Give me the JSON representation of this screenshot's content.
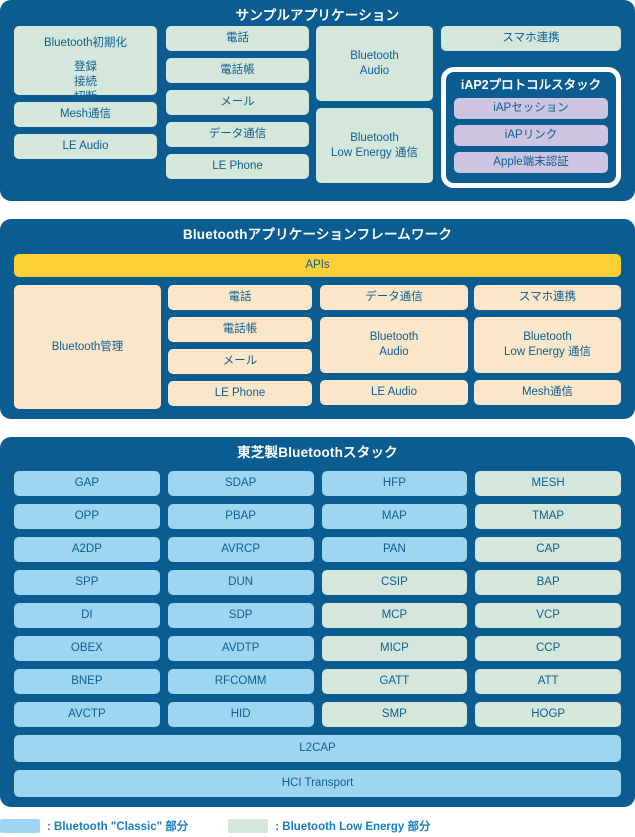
{
  "colors": {
    "panel_navy": "#0a5c91",
    "classic_blue": "#9ed5f0",
    "low_energy_green": "#d5e7da",
    "framework_beige": "#fae6c8",
    "apis_yellow": "#fbd034",
    "iap_purple": "#ccc4e0",
    "box_text": "#0f5e94",
    "legend_text": "#1a7fc1"
  },
  "sample_application": {
    "title": "サンプルアプリケーション",
    "column1": {
      "init_box": {
        "heading": "Bluetooth初期化",
        "lines": "登録\n接続\n切断"
      },
      "mesh": "Mesh通信",
      "le_audio": "LE Audio"
    },
    "column2": {
      "phone": "電話",
      "phonebook": "電話帳",
      "mail": "メール",
      "data_comm": "データ通信",
      "le_phone": "LE Phone"
    },
    "column3": {
      "bt_audio": "Bluetooth\nAudio",
      "bt_le_comm": "Bluetooth\nLow Energy 通信"
    },
    "column4": {
      "smartphone_link": "スマホ連携"
    },
    "iap2": {
      "title": "iAP2プロトコルスタック",
      "items": [
        "iAPセッション",
        "iAPリンク",
        "Apple端末認証"
      ]
    }
  },
  "framework": {
    "title": "Bluetoothアプリケーションフレームワーク",
    "apis": "APIs",
    "column1": {
      "management": "Bluetooth管理"
    },
    "column2": {
      "phone": "電話",
      "phonebook": "電話帳",
      "mail": "メール",
      "le_phone": "LE Phone"
    },
    "column3": {
      "data_comm": "データ通信",
      "bt_audio": "Bluetooth\nAudio",
      "le_audio": "LE Audio"
    },
    "column4": {
      "smartphone_link": "スマホ連携",
      "bt_le_comm": "Bluetooth\nLow Energy 通信",
      "mesh": "Mesh通信"
    }
  },
  "stack": {
    "title": "東芝製Bluetoothスタック",
    "grid": [
      [
        {
          "label": "GAP",
          "kind": "blue"
        },
        {
          "label": "SDAP",
          "kind": "blue"
        },
        {
          "label": "HFP",
          "kind": "blue"
        },
        {
          "label": "MESH",
          "kind": "green"
        }
      ],
      [
        {
          "label": "OPP",
          "kind": "blue"
        },
        {
          "label": "PBAP",
          "kind": "blue"
        },
        {
          "label": "MAP",
          "kind": "blue"
        },
        {
          "label": "TMAP",
          "kind": "green"
        }
      ],
      [
        {
          "label": "A2DP",
          "kind": "blue"
        },
        {
          "label": "AVRCP",
          "kind": "blue"
        },
        {
          "label": "PAN",
          "kind": "blue"
        },
        {
          "label": "CAP",
          "kind": "green"
        }
      ],
      [
        {
          "label": "SPP",
          "kind": "blue"
        },
        {
          "label": "DUN",
          "kind": "blue"
        },
        {
          "label": "CSIP",
          "kind": "green"
        },
        {
          "label": "BAP",
          "kind": "green"
        }
      ],
      [
        {
          "label": "DI",
          "kind": "blue"
        },
        {
          "label": "SDP",
          "kind": "blue"
        },
        {
          "label": "MCP",
          "kind": "green"
        },
        {
          "label": "VCP",
          "kind": "green"
        }
      ],
      [
        {
          "label": "OBEX",
          "kind": "blue"
        },
        {
          "label": "AVDTP",
          "kind": "blue"
        },
        {
          "label": "MICP",
          "kind": "green"
        },
        {
          "label": "CCP",
          "kind": "green"
        }
      ],
      [
        {
          "label": "BNEP",
          "kind": "blue"
        },
        {
          "label": "RFCOMM",
          "kind": "blue"
        },
        {
          "label": "GATT",
          "kind": "green"
        },
        {
          "label": "ATT",
          "kind": "green"
        }
      ],
      [
        {
          "label": "AVCTP",
          "kind": "blue"
        },
        {
          "label": "HID",
          "kind": "blue"
        },
        {
          "label": "SMP",
          "kind": "green"
        },
        {
          "label": "HOGP",
          "kind": "green"
        }
      ]
    ],
    "full_width_rows": [
      {
        "label": "L2CAP",
        "kind": "blue"
      },
      {
        "label": "HCI Transport",
        "kind": "blue"
      }
    ]
  },
  "legend": {
    "classic": ": Bluetooth \"Classic\" 部分",
    "low_energy": ": Bluetooth Low Energy 部分"
  }
}
